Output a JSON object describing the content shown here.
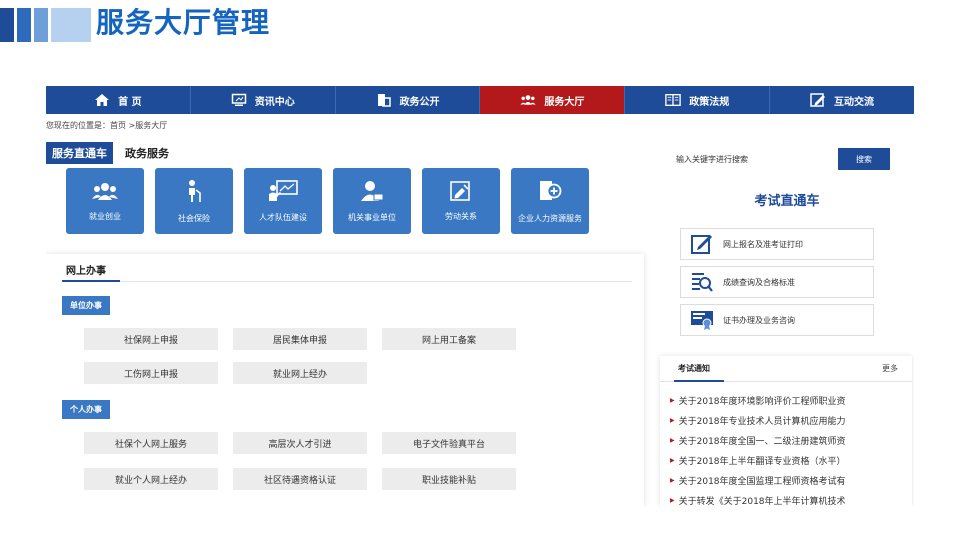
{
  "slide": {
    "title": "服务大厅管理",
    "bar_colors": [
      "#1e4c99",
      "#2f6bbd",
      "#6f9fd8",
      "#b6d0ef"
    ]
  },
  "colors": {
    "nav_bg": "#1e4c99",
    "nav_active": "#b3191a",
    "tile_bg": "#3a78c3",
    "accent_blue": "#1e4c99",
    "bullet_red": "#b3191a"
  },
  "nav": {
    "items": [
      {
        "label": "首 页",
        "icon": "home-icon"
      },
      {
        "label": "资讯中心",
        "icon": "monitor-icon"
      },
      {
        "label": "政务公开",
        "icon": "document-icon"
      },
      {
        "label": "服务大厅",
        "icon": "people-icon",
        "active": true
      },
      {
        "label": "政策法规",
        "icon": "book-icon"
      },
      {
        "label": "互动交流",
        "icon": "edit-icon"
      }
    ]
  },
  "breadcrumb": {
    "text": "您现在的位置是：首页 >服务大厅"
  },
  "service_tabs": {
    "active": "服务直通车",
    "other": "政务服务"
  },
  "tiles": [
    {
      "label": "就业创业",
      "icon": "group-icon"
    },
    {
      "label": "社会保险",
      "icon": "elderly-icon"
    },
    {
      "label": "人才队伍建设",
      "icon": "presentation-icon"
    },
    {
      "label": "机关事业单位",
      "icon": "user-badge-icon"
    },
    {
      "label": "劳动关系",
      "icon": "handshake-icon"
    },
    {
      "label": "企业人力资源服务",
      "icon": "shield-plus-icon"
    }
  ],
  "online": {
    "title": "网上办事",
    "unit": {
      "label": "单位办事",
      "items": [
        "社保网上申报",
        "居民集体申报",
        "网上用工备案",
        "工伤网上申报",
        "就业网上经办"
      ]
    },
    "personal": {
      "label": "个人办事",
      "items": [
        "社保个人网上服务",
        "高层次人才引进",
        "电子文件验真平台",
        "就业个人网上经办",
        "社区待遇资格认证",
        "职业技能补贴"
      ]
    }
  },
  "search": {
    "placeholder": "输入关键字进行搜索",
    "button": "搜索"
  },
  "exam": {
    "title": "考试直通车",
    "links": [
      {
        "label": "网上报名及准考证打印",
        "icon": "pen-icon"
      },
      {
        "label": "成绩查询及合格标准",
        "icon": "search-list-icon"
      },
      {
        "label": "证书办理及业务咨询",
        "icon": "certificate-icon"
      }
    ]
  },
  "notice": {
    "title": "考试通知",
    "more": "更多",
    "items": [
      "关于2018年度环境影响评价工程师职业资",
      "关于2018年专业技术人员计算机应用能力",
      "关于2018年度全国一、二级注册建筑师资",
      "关于2018年上半年翻译专业资格（水平）",
      "关于2018年度全国监理工程师资格考试有",
      "关于转发《关于2018年上半年计算机技术"
    ]
  }
}
